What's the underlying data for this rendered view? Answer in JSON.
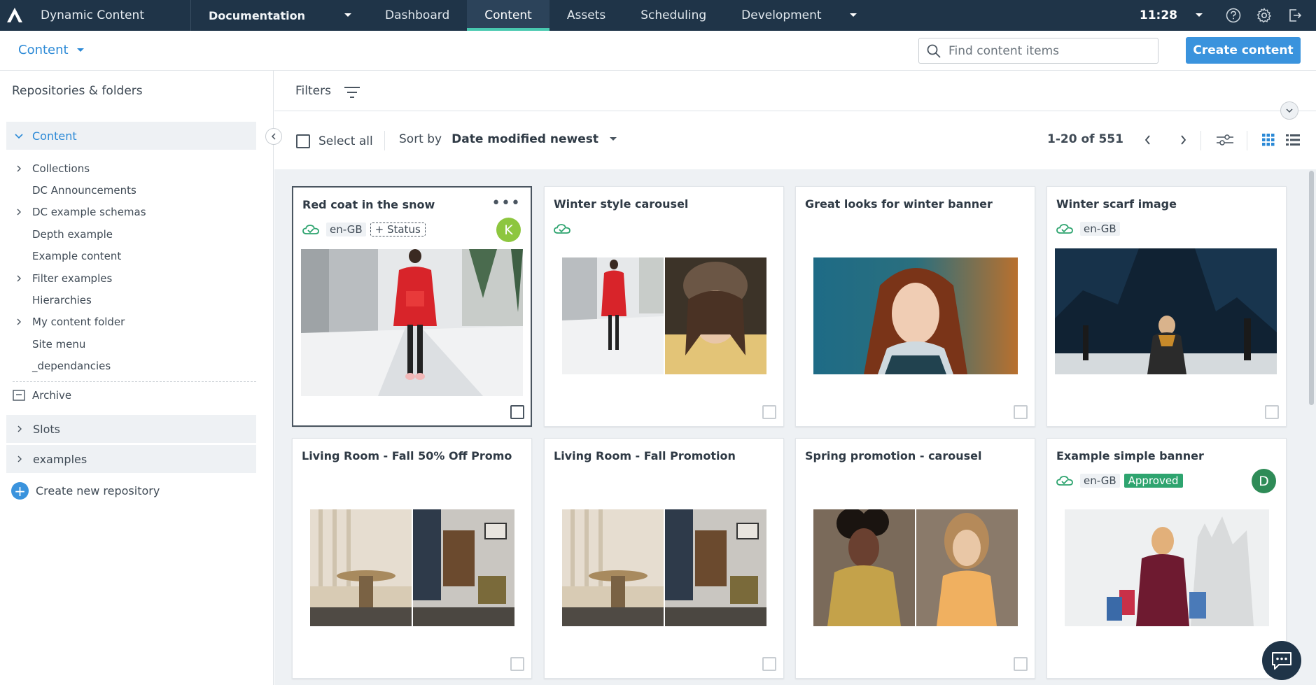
{
  "topbar": {
    "app_title": "Dynamic Content",
    "hub": "Documentation",
    "tabs": [
      {
        "label": "Dashboard"
      },
      {
        "label": "Content",
        "active": true
      },
      {
        "label": "Assets"
      },
      {
        "label": "Scheduling"
      },
      {
        "label": "Development"
      }
    ],
    "time": "11:28",
    "colors": {
      "bar": "#1f3448",
      "active_tab": "#2c435a",
      "active_underline": "#48c9b0"
    }
  },
  "subheader": {
    "title": "Content",
    "search_placeholder": "Find content items",
    "create_label": "Create content",
    "accent": "#3a93dd"
  },
  "sidebar": {
    "heading": "Repositories & folders",
    "root": "Content",
    "folders": [
      {
        "label": "Collections",
        "expandable": true
      },
      {
        "label": "DC Announcements",
        "expandable": false
      },
      {
        "label": "DC example schemas",
        "expandable": true
      },
      {
        "label": "Depth example",
        "expandable": false
      },
      {
        "label": "Example content",
        "expandable": false
      },
      {
        "label": "Filter examples",
        "expandable": true
      },
      {
        "label": "Hierarchies",
        "expandable": false
      },
      {
        "label": "My content folder",
        "expandable": true
      },
      {
        "label": "Site menu",
        "expandable": false
      },
      {
        "label": "_dependancies",
        "expandable": false
      }
    ],
    "archive": "Archive",
    "repositories": [
      {
        "label": "Slots"
      },
      {
        "label": "examples"
      }
    ],
    "create_repo": "Create new repository"
  },
  "filters": {
    "label": "Filters"
  },
  "toolbar": {
    "select_all": "Select all",
    "sort_by_label": "Sort by",
    "sort_value": "Date modified newest",
    "page_count": "1-20 of 551"
  },
  "cards": [
    {
      "title": "Red coat in the snow",
      "locale": "en-GB",
      "status": "+ Status",
      "avatar": "K",
      "avatar_color": "#8dc63f",
      "selected": true,
      "menu": true
    },
    {
      "title": "Winter style carousel",
      "locale": "",
      "status": "",
      "avatar": ""
    },
    {
      "title": "Great looks for winter banner",
      "locale": "",
      "status": "",
      "avatar": ""
    },
    {
      "title": "Winter scarf image",
      "locale": "en-GB",
      "status": "",
      "avatar": ""
    },
    {
      "title": "Living Room - Fall 50% Off Promo...",
      "locale": "",
      "status": "",
      "avatar": ""
    },
    {
      "title": "Living Room - Fall Promotion",
      "locale": "",
      "status": "",
      "avatar": ""
    },
    {
      "title": "Spring promotion - carousel",
      "locale": "",
      "status": "",
      "avatar": ""
    },
    {
      "title": "Example simple banner",
      "locale": "en-GB",
      "status": "Approved",
      "avatar": "D",
      "avatar_color": "#2e8b57"
    }
  ],
  "icons": {
    "logo": "amplience-logo-icon",
    "help": "help-icon",
    "settings": "gear-icon",
    "logout": "logout-icon",
    "search": "search-icon",
    "filter": "filter-icon",
    "cloud": "cloud-published-icon",
    "chat": "chat-icon"
  },
  "status_colors": {
    "published": "#2ea46f",
    "approved": "#2ea46f"
  }
}
